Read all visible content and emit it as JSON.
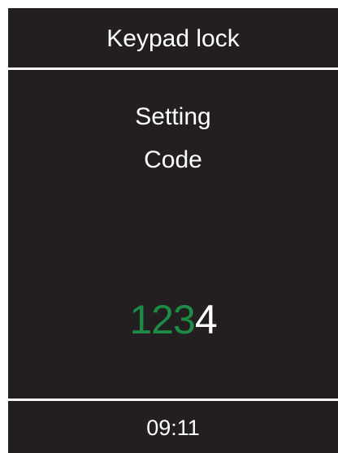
{
  "header": {
    "title": "Keypad lock"
  },
  "message": {
    "line1": "Setting",
    "line2": "Code"
  },
  "code": {
    "entered_digits": "123",
    "current_digit": "4",
    "entered_color": "#1d8a45",
    "current_color": "#ffffff"
  },
  "status": {
    "time": "09:11"
  },
  "colors": {
    "background": "#231f20",
    "text": "#ffffff",
    "accent": "#1d8a45"
  }
}
